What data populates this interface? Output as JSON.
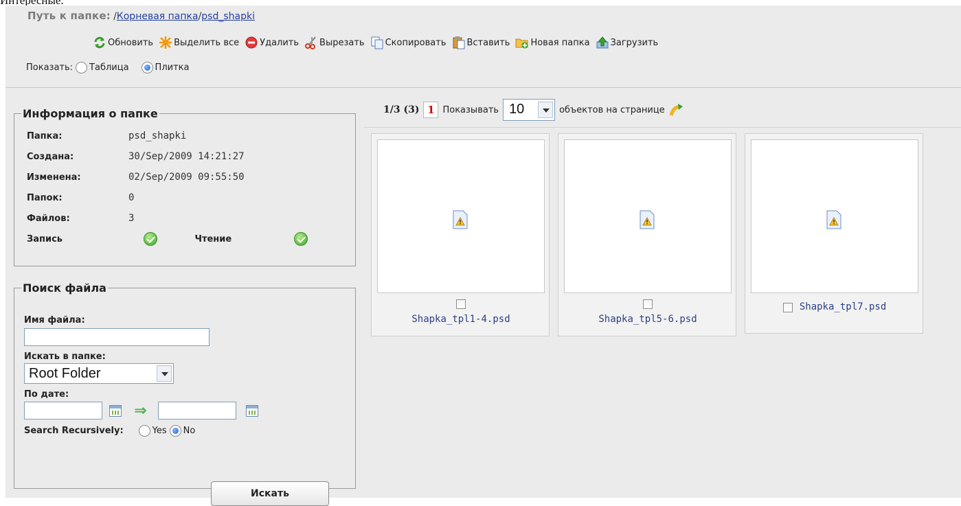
{
  "pretext": "Интересные.",
  "path": {
    "label": "Путь к папке:",
    "segments": [
      "Корневая папка",
      "psd_shapki"
    ]
  },
  "toolbar": {
    "refresh": "Обновить",
    "select_all": "Выделить все",
    "delete": "Удалить",
    "cut": "Вырезать",
    "copy": "Скопировать",
    "paste": "Вставить",
    "new_folder": "Новая папка",
    "upload": "Загрузить"
  },
  "view": {
    "label": "Показать:",
    "table": "Таблица",
    "tiles": "Плитка",
    "selected": "tiles"
  },
  "info": {
    "legend": "Информация о папке",
    "rows": [
      {
        "k": "Папка:",
        "v": "psd_shapki"
      },
      {
        "k": "Создана:",
        "v": "30/Sep/2009 14:21:27"
      },
      {
        "k": "Изменена:",
        "v": "02/Sep/2009 09:55:50"
      },
      {
        "k": "Папок:",
        "v": "0"
      },
      {
        "k": "Файлов:",
        "v": "3"
      }
    ],
    "write_label": "Запись",
    "read_label": "Чтение"
  },
  "search": {
    "legend": "Поиск файла",
    "filename_label": "Имя файла:",
    "folder_label": "Искать в папке:",
    "folder_value": "Root Folder",
    "date_label": "По дате:",
    "recursive_label": "Search Recursively:",
    "yes": "Yes",
    "no": "No",
    "recursive_selected": "no",
    "button": "Искать"
  },
  "pager": {
    "count": "1/3 (3)",
    "page": "1",
    "show_label": "Показывать",
    "per_page": "10",
    "suffix": "объектов на странице"
  },
  "files": [
    {
      "name": "Shapka_tpl1-4.psd"
    },
    {
      "name": "Shapka_tpl5-6.psd"
    },
    {
      "name": "Shapka_tpl7.psd"
    }
  ],
  "colors": {
    "panel": "#ebebeb",
    "link": "#2440a0",
    "accent_green": "#3aa52a"
  }
}
